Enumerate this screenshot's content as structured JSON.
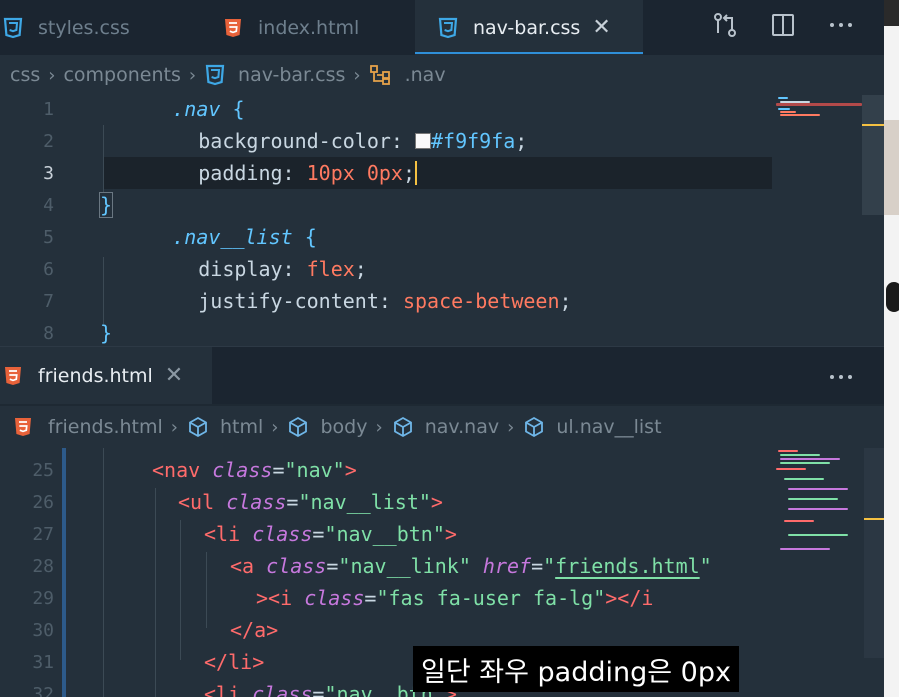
{
  "top_tabs": [
    {
      "label": "styles.css",
      "icon": "css-file-icon"
    },
    {
      "label": "index.html",
      "icon": "html-file-icon"
    },
    {
      "label": "nav-bar.css",
      "icon": "css-file-icon",
      "active": true
    }
  ],
  "top_breadcrumb": [
    "css",
    "components",
    "nav-bar.css",
    ".nav"
  ],
  "css_lines": [
    {
      "n": "1"
    },
    {
      "n": "2"
    },
    {
      "n": "3"
    },
    {
      "n": "4"
    },
    {
      "n": "5"
    },
    {
      "n": "6"
    },
    {
      "n": "7"
    },
    {
      "n": "8"
    }
  ],
  "css_code": {
    "l1_sel": ".nav",
    "l1_brace": " {",
    "l2_prop": "background-color:",
    "l2_val": "#f9f9fa",
    "l2_end": ";",
    "l3_prop": "padding:",
    "l3_val": "10px 0px",
    "l3_end": ";",
    "l4": "}",
    "l5_sel": ".nav__list",
    "l5_brace": " {",
    "l6_prop": "display:",
    "l6_val": "flex",
    "l6_end": ";",
    "l7_prop": "justify-content:",
    "l7_val": "space-between",
    "l7_end": ";",
    "l8": "}"
  },
  "swatch_color": "#f9f9fa",
  "bottom_tab": {
    "label": "friends.html",
    "icon": "html-file-icon"
  },
  "bottom_breadcrumb": [
    "friends.html",
    "html",
    "body",
    "nav.nav",
    "ul.nav__list"
  ],
  "html_lines": [
    "25",
    "26",
    "27",
    "28",
    "29",
    "30",
    "31",
    "32"
  ],
  "html_code": {
    "l25": {
      "lt": "<",
      "tag": "nav",
      "attr": "class",
      "eq": "=",
      "str": "\"nav\"",
      "gt": ">"
    },
    "l26": {
      "lt": "<",
      "tag": "ul",
      "attr": "class",
      "eq": "=",
      "str": "\"nav__list\"",
      "gt": ">"
    },
    "l27": {
      "lt": "<",
      "tag": "li",
      "attr": "class",
      "eq": "=",
      "str": "\"nav__btn\"",
      "gt": ">"
    },
    "l28": {
      "lt": "<",
      "tag": "a",
      "attr": "class",
      "eq": "=",
      "str": "\"nav__link\"",
      "attr2": "href",
      "eq2": "=",
      "str2a": "\"",
      "str2b": "friends.html",
      "str2c": "\""
    },
    "l29": {
      "lt": "><",
      "tag": "i",
      "attr": "class",
      "eq": "=",
      "str": "\"fas fa-user fa-lg\"",
      "gt": "></",
      "tag2": "i"
    },
    "l30": {
      "lt": "</",
      "tag": "a",
      "gt": ">"
    },
    "l31": {
      "lt": "</",
      "tag": "li",
      "gt": ">"
    },
    "l32": {
      "lt": "<",
      "tag": "li",
      "attr": "class",
      "eq": "=",
      "str": "\"nav__btn\"",
      "gt": ">"
    }
  },
  "subtitle": "일단 좌우 padding은 0px",
  "colors": {
    "accent": "#2f8fd8",
    "css_icon": "#3ea8e6",
    "html_icon": "#e8623a",
    "cursor": "#f5c142"
  }
}
